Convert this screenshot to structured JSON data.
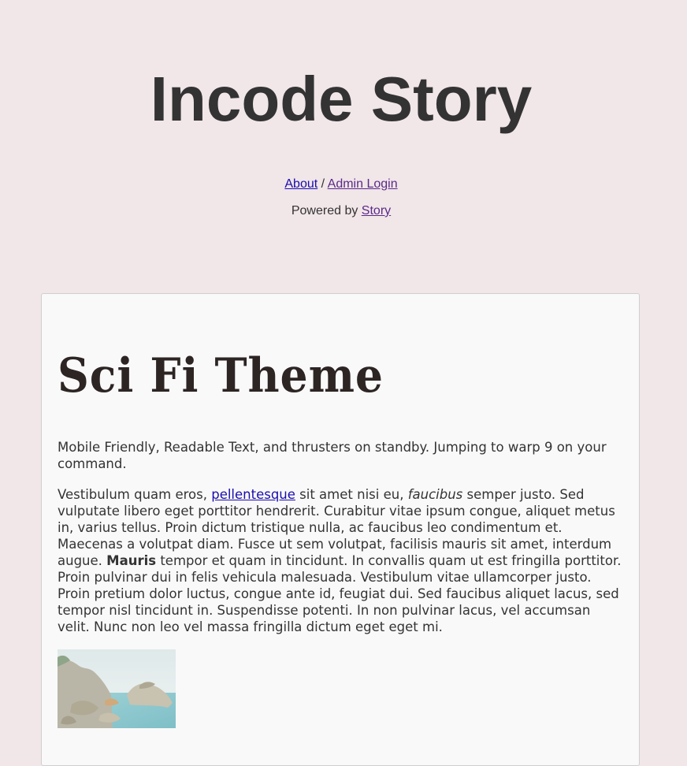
{
  "site": {
    "title": "Incode Story",
    "nav": {
      "about": "About",
      "separator": "/",
      "admin_login": "Admin Login"
    },
    "powered_prefix": "Powered by",
    "powered_link": "Story"
  },
  "post": {
    "title": "Sci Fi Theme",
    "intro": "Mobile Friendly, Readable Text, and thrusters on standby. Jumping to warp 9 on your command.",
    "paragraph": {
      "part1": "Vestibulum quam eros, ",
      "link": "pellentesque",
      "part2": " sit amet nisi eu, ",
      "italic": "faucibus",
      "part3": " semper justo. Sed vulputate libero eget porttitor hendrerit. Curabitur vitae ipsum congue, aliquet metus in, varius tellus. Proin dictum tristique nulla, ac faucibus leo condimentum et. Maecenas a volutpat diam. Fusce ut sem volutpat, facilisis mauris sit amet, interdum augue. ",
      "bold": "Mauris",
      "part4": " tempor et quam in tincidunt. In convallis quam ut est fringilla porttitor. Proin pulvinar dui in felis vehicula malesuada. Vestibulum vitae ullamcorper justo. Proin pretium dolor luctus, congue ante id, feugiat dui. Sed faucibus aliquet lacus, sed tempor nisl tincidunt in. Suspendisse potenti. In non pulvinar lacus, vel accumsan velit. Nunc non leo vel massa fringilla dictum eget eget mi."
    }
  }
}
